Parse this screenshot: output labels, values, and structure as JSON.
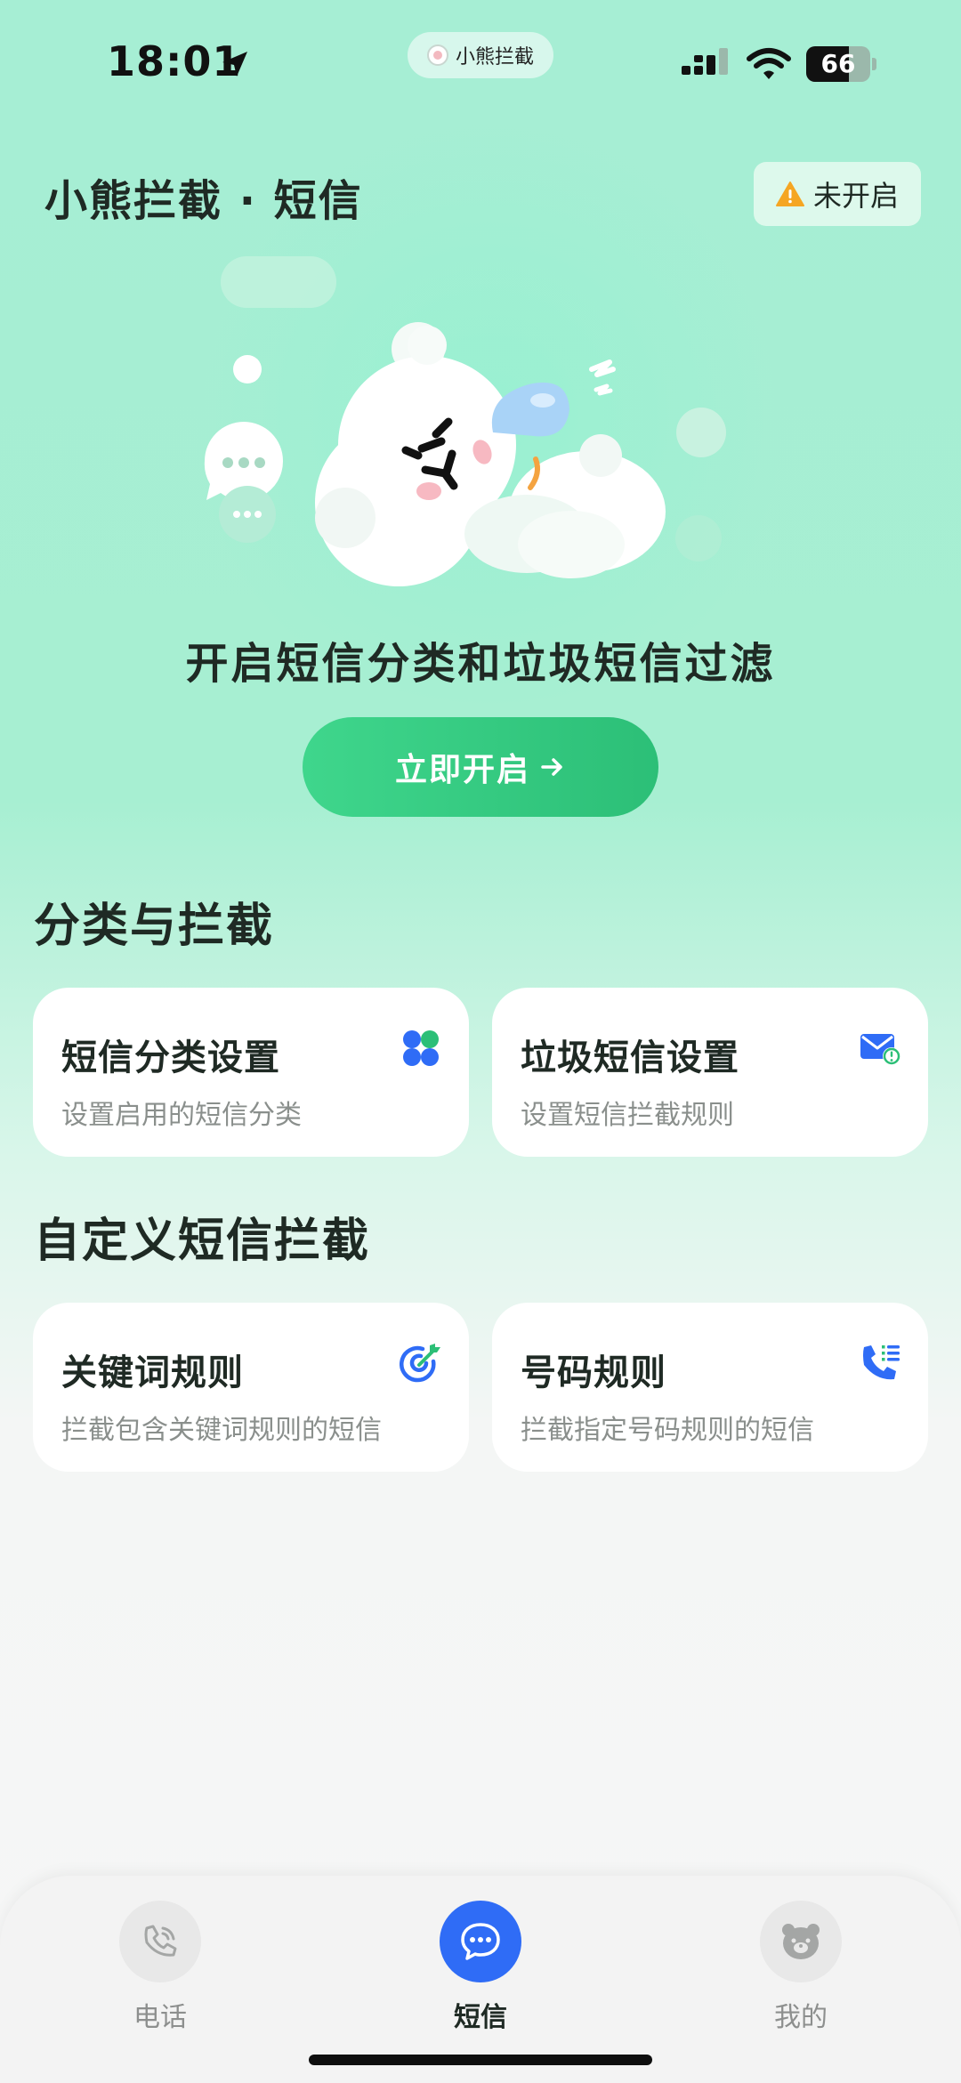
{
  "status_bar": {
    "time": "18:01",
    "island_text": "小熊拦截",
    "battery": "66",
    "battery_level_percent": 66
  },
  "header": {
    "title": "小熊拦截 · 短信",
    "status_label": "未开启"
  },
  "hero": {
    "headline": "开启短信分类和垃圾短信过滤",
    "cta_label": "立即开启"
  },
  "sections": {
    "classify": {
      "title": "分类与拦截",
      "cards": [
        {
          "title": "短信分类设置",
          "subtitle": "设置启用的短信分类",
          "icon": "clover-icon"
        },
        {
          "title": "垃圾短信设置",
          "subtitle": "设置短信拦截规则",
          "icon": "mail-alert-icon"
        }
      ]
    },
    "custom": {
      "title": "自定义短信拦截",
      "cards": [
        {
          "title": "关键词规则",
          "subtitle": "拦截包含关键词规则的短信",
          "icon": "target-icon"
        },
        {
          "title": "号码规则",
          "subtitle": "拦截指定号码规则的短信",
          "icon": "phone-list-icon"
        }
      ]
    }
  },
  "tabbar": {
    "tabs": [
      {
        "label": "电话",
        "icon": "phone-icon",
        "active": false
      },
      {
        "label": "短信",
        "icon": "chat-bubble-icon",
        "active": true
      },
      {
        "label": "我的",
        "icon": "bear-face-icon",
        "active": false
      }
    ]
  },
  "colors": {
    "accent_green": "#3fd68c",
    "tab_active_blue": "#2f6cf6",
    "card_icon_blue": "#2f6cf6",
    "card_icon_green": "#2cbf77",
    "warning_orange": "#f5a623"
  }
}
